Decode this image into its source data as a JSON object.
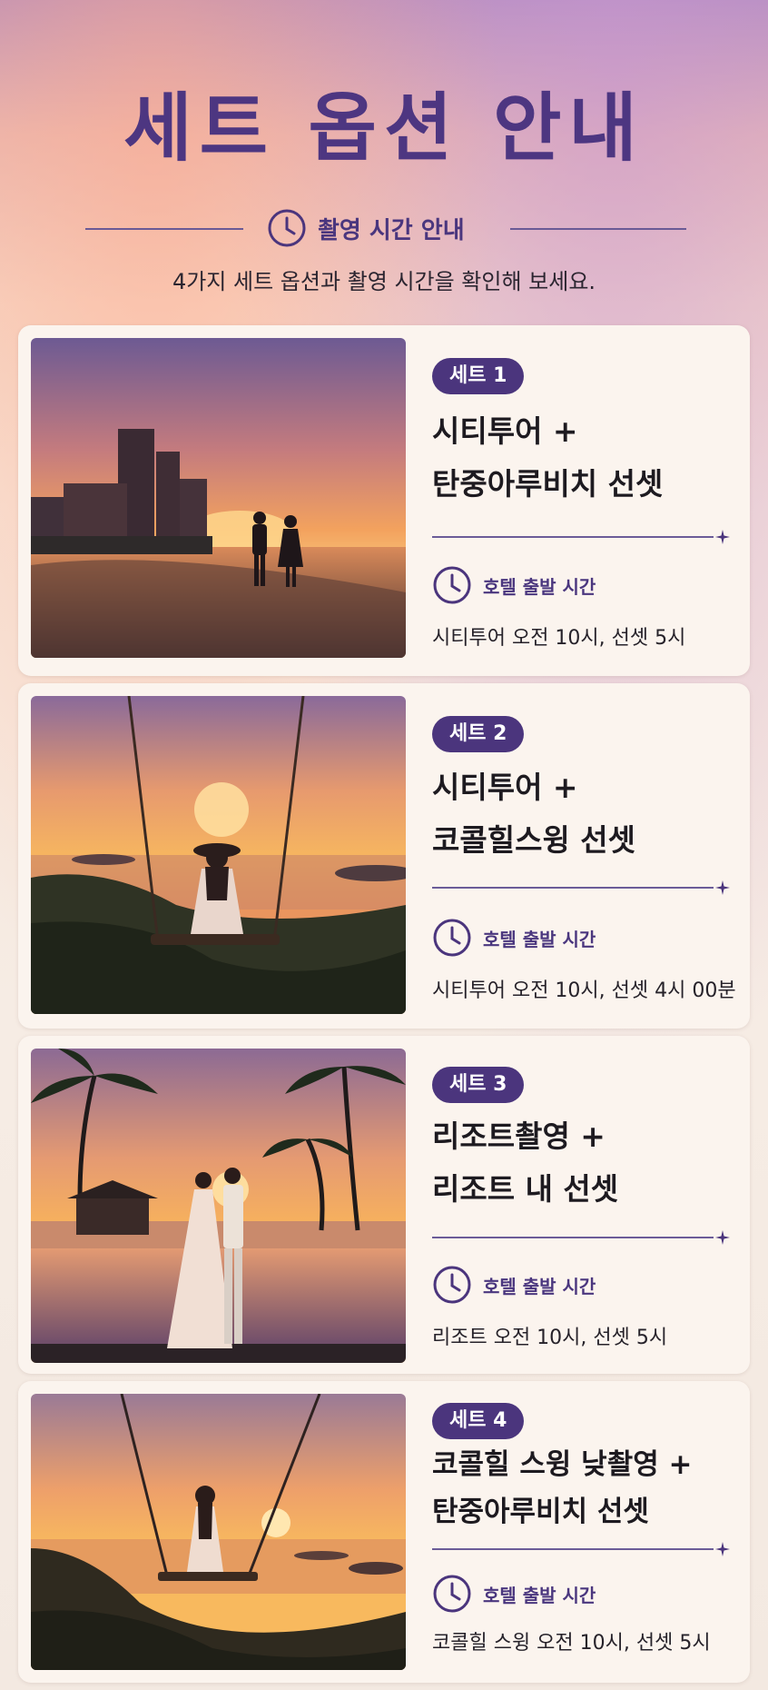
{
  "header": {
    "title": "세트 옵션 안내",
    "subtitle": "촬영 시간 안내",
    "description": "4가지 세트 옵션과 촬영 시간을 확인해 보세요."
  },
  "colors": {
    "accent": "#4b357d",
    "card_background": "#fbf4ee",
    "text": "#1d1a20"
  },
  "icons": [
    "clock-icon",
    "sparkle-icon"
  ],
  "sets": [
    {
      "badge": "세트 1",
      "title": "시티투어 +\n탄중아루비치 선셋",
      "time_label": "호텔 출발 시간",
      "time_value": "시티투어 오전 10시, 선셋 5시",
      "photo": "couple-walking-beach-sunset"
    },
    {
      "badge": "세트 2",
      "title": "시티투어 +\n코콜힐스윙 선셋",
      "time_label": "호텔 출발 시간",
      "time_value": "시티투어 오전 10시, 선셋 4시 00분",
      "photo": "woman-hat-swing-sunset"
    },
    {
      "badge": "세트 3",
      "title": "리조트촬영 +\n리조트 내 선셋",
      "time_label": "호텔 출발 시간",
      "time_value": "리조트 오전 10시, 선셋 5시",
      "photo": "couple-pool-palms-sunset"
    },
    {
      "badge": "세트 4",
      "title": "코콜힐 스윙 낮촬영 +\n탄중아루비치 선셋",
      "time_label": "호텔 출발 시간",
      "time_value": "코콜힐 스윙 오전 10시, 선셋 5시",
      "photo": "woman-swing-sea-sunset"
    }
  ]
}
